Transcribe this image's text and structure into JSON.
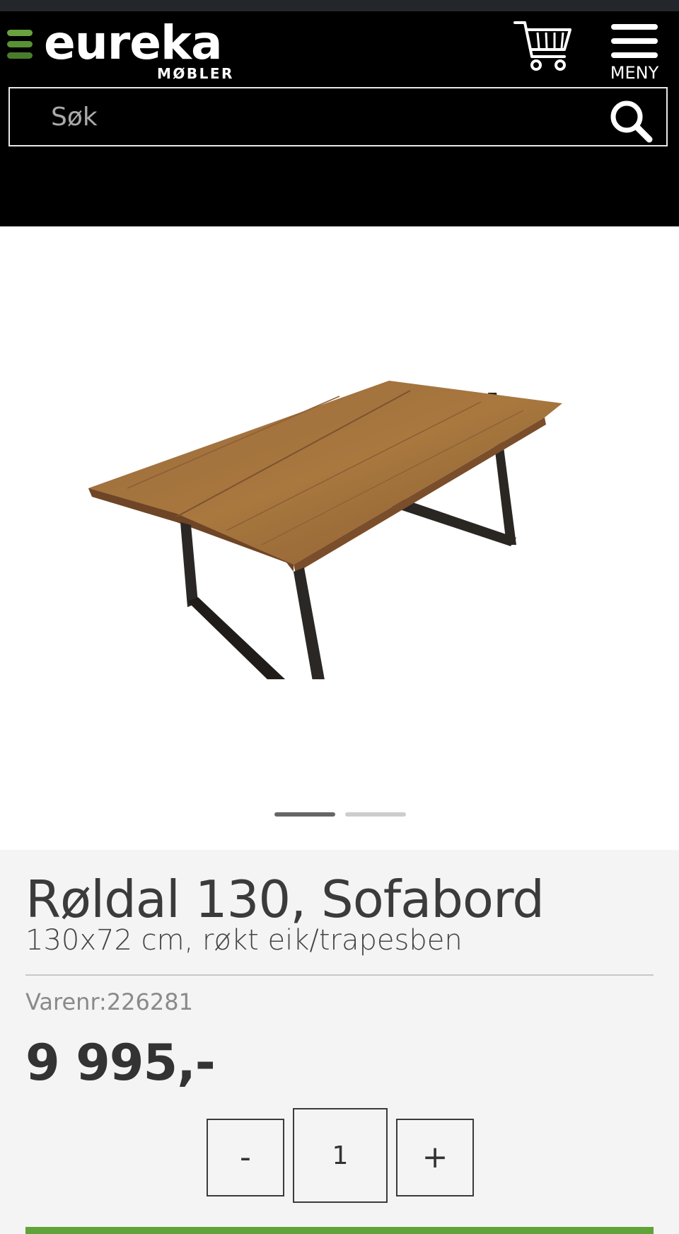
{
  "header": {
    "logo_text": "eureka",
    "logo_subtitle": "MØBLER",
    "cart_icon": "shopping-cart-icon",
    "menu_label": "MENY",
    "brand_green": "#6aa23f",
    "background": "#000000"
  },
  "search": {
    "placeholder": "Søk",
    "icon": "search-icon"
  },
  "gallery": {
    "image_alt": "Røldal 130, Sofabord",
    "slide_count": 2,
    "active_slide": 1
  },
  "product": {
    "title": "Røldal 130, Sofabord",
    "subtitle": "130x72 cm, røkt eik/trapesben",
    "sku_label": "Varenr:",
    "sku_value": "226281",
    "price": "9 995,-"
  },
  "quantity": {
    "minus_label": "-",
    "value": "1",
    "plus_label": "+"
  },
  "colors": {
    "accent_green": "#5fa33a",
    "page_bg": "#f4f4f4",
    "text": "#3b3b3b"
  }
}
